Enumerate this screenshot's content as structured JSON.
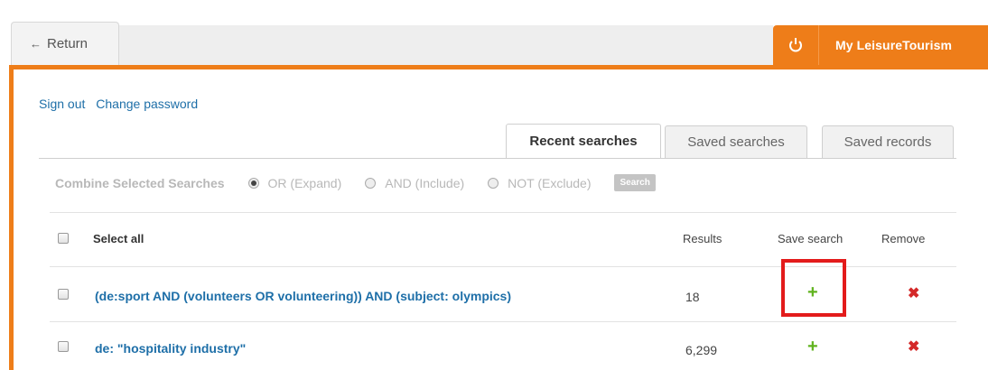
{
  "header": {
    "return_label": "Return",
    "my_label": "My LeisureTourism"
  },
  "account_links": [
    "Sign out",
    "Change password"
  ],
  "tabs": [
    {
      "label": "Recent searches",
      "active": true
    },
    {
      "label": "Saved searches",
      "active": false
    },
    {
      "label": "Saved records",
      "active": false
    }
  ],
  "combine": {
    "title": "Combine Selected Searches",
    "options": [
      {
        "label": "OR (Expand)",
        "selected": true
      },
      {
        "label": "AND (Include)",
        "selected": false
      },
      {
        "label": "NOT (Exclude)",
        "selected": false
      }
    ],
    "button": "Search"
  },
  "table": {
    "select_all": "Select all",
    "col_results": "Results",
    "col_save": "Save search",
    "col_remove": "Remove",
    "rows": [
      {
        "query": "(de:sport AND (volunteers OR volunteering)) AND (subject: olympics)",
        "results": "18"
      },
      {
        "query": "de: \"hospitality industry\"",
        "results": "6,299"
      }
    ]
  },
  "colors": {
    "brand": "#ee7d19",
    "link": "#1e6fa8",
    "add": "#60b31e",
    "remove": "#d42828",
    "highlight": "#e31b1b"
  }
}
